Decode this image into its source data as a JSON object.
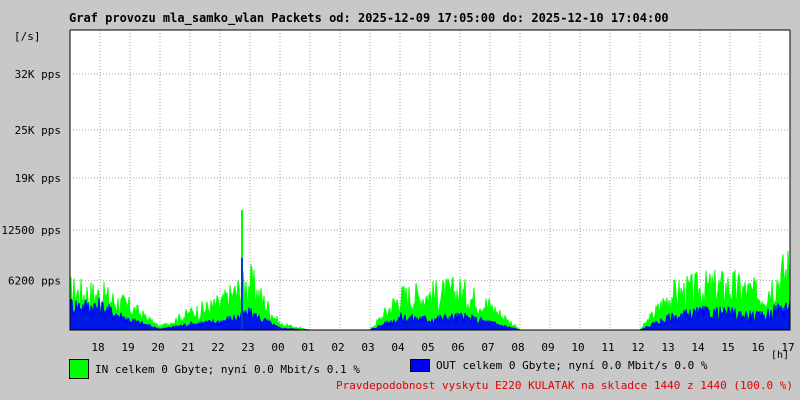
{
  "title": "Graf provozu mla_samko_wlan Packets od: 2025-12-09 17:05:00 do: 2025-12-10 17:04:00",
  "unit_label": "[/s]",
  "hours_label": "[h]",
  "legend": {
    "in": {
      "text": "IN celkem 0 Gbyte; nyní   0.0 Mbit/s 0.1 %",
      "color": "#00ff00"
    },
    "out": {
      "text": "OUT celkem 0 Gbyte; nyní   0.0 Mbit/s 0.0 %",
      "color": "#0000ff"
    }
  },
  "note": "Pravdepodobnost vyskytu E220 KULATAK na skladce 1440 z 1440 (100.0 %)",
  "colors": {
    "background": "#c8c8c8",
    "plot": "#ffffff",
    "grid": "#a0a0a0",
    "note": "#e00000"
  },
  "chart_data": {
    "type": "area",
    "title": "Graf provozu mla_samko_wlan Packets od: 2025-12-09 17:05:00 do: 2025-12-10 17:04:00",
    "ylabel": "[/s]",
    "xlabel": "[h]",
    "ylim": [
      0,
      37500
    ],
    "grid": true,
    "y_ticks": [
      {
        "value": 6200,
        "label": "6200 pps"
      },
      {
        "value": 12500,
        "label": "12500 pps"
      },
      {
        "value": 19000,
        "label": "19K pps"
      },
      {
        "value": 25000,
        "label": "25K pps"
      },
      {
        "value": 32000,
        "label": "32K pps"
      }
    ],
    "x_ticks": [
      "18",
      "19",
      "20",
      "21",
      "22",
      "23",
      "00",
      "01",
      "02",
      "03",
      "04",
      "05",
      "06",
      "07",
      "08",
      "09",
      "10",
      "11",
      "12",
      "13",
      "14",
      "15",
      "16",
      "17"
    ],
    "x": [
      "17",
      "18",
      "19",
      "20",
      "21",
      "22",
      "23",
      "00",
      "01",
      "02",
      "03",
      "04",
      "05",
      "06",
      "07",
      "08",
      "09",
      "10",
      "11",
      "12",
      "13",
      "14",
      "15",
      "16",
      "17"
    ],
    "series": [
      {
        "name": "IN",
        "color": "#00ff00",
        "values": [
          4200,
          3800,
          2500,
          300,
          1800,
          2800,
          5200,
          600,
          0,
          0,
          0,
          3600,
          3800,
          4200,
          2600,
          0,
          0,
          0,
          0,
          0,
          3800,
          4500,
          4800,
          3800,
          6800
        ]
      },
      {
        "name": "OUT",
        "color": "#0000ff",
        "values": [
          3000,
          2800,
          1200,
          100,
          700,
          1000,
          2000,
          200,
          0,
          0,
          0,
          1500,
          1300,
          1600,
          900,
          0,
          0,
          0,
          0,
          0,
          1500,
          2100,
          2000,
          1600,
          3000
        ]
      }
    ]
  }
}
